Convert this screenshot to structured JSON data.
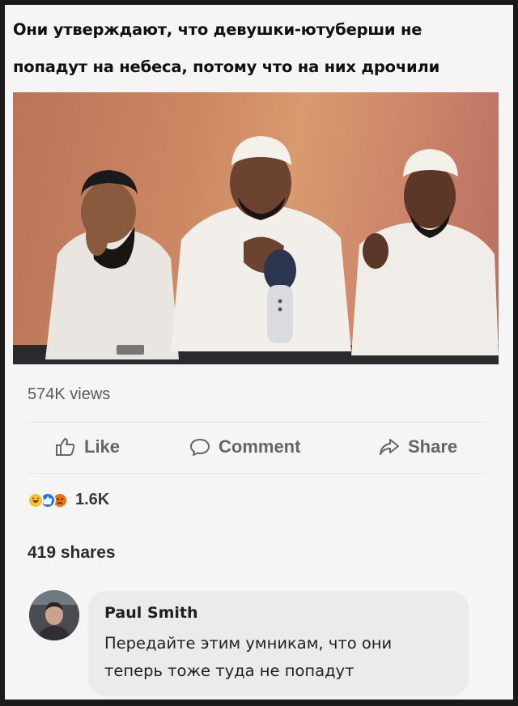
{
  "meme": {
    "caption_line1": "Они утверждают, что девушки-ютуберши не",
    "caption_line2": "попадут на небеса, потому что на них дрочили"
  },
  "post": {
    "views": "574K views",
    "actions": {
      "like": "Like",
      "comment": "Comment",
      "share": "Share"
    },
    "reactions": {
      "icons": [
        "haha-icon",
        "like-icon",
        "angry-icon"
      ],
      "count": "1.6K"
    },
    "shares": "419 shares"
  },
  "comment": {
    "author": "Paul Smith",
    "text_line1": "Передайте этим умникам, что они",
    "text_line2": "теперь тоже туда не попадут"
  },
  "colors": {
    "background": "#f5f5f5",
    "bubble": "#ebebeb",
    "like_blue": "#1877f2",
    "haha_yellow": "#f7c12e",
    "angry_orange": "#e9710f"
  }
}
